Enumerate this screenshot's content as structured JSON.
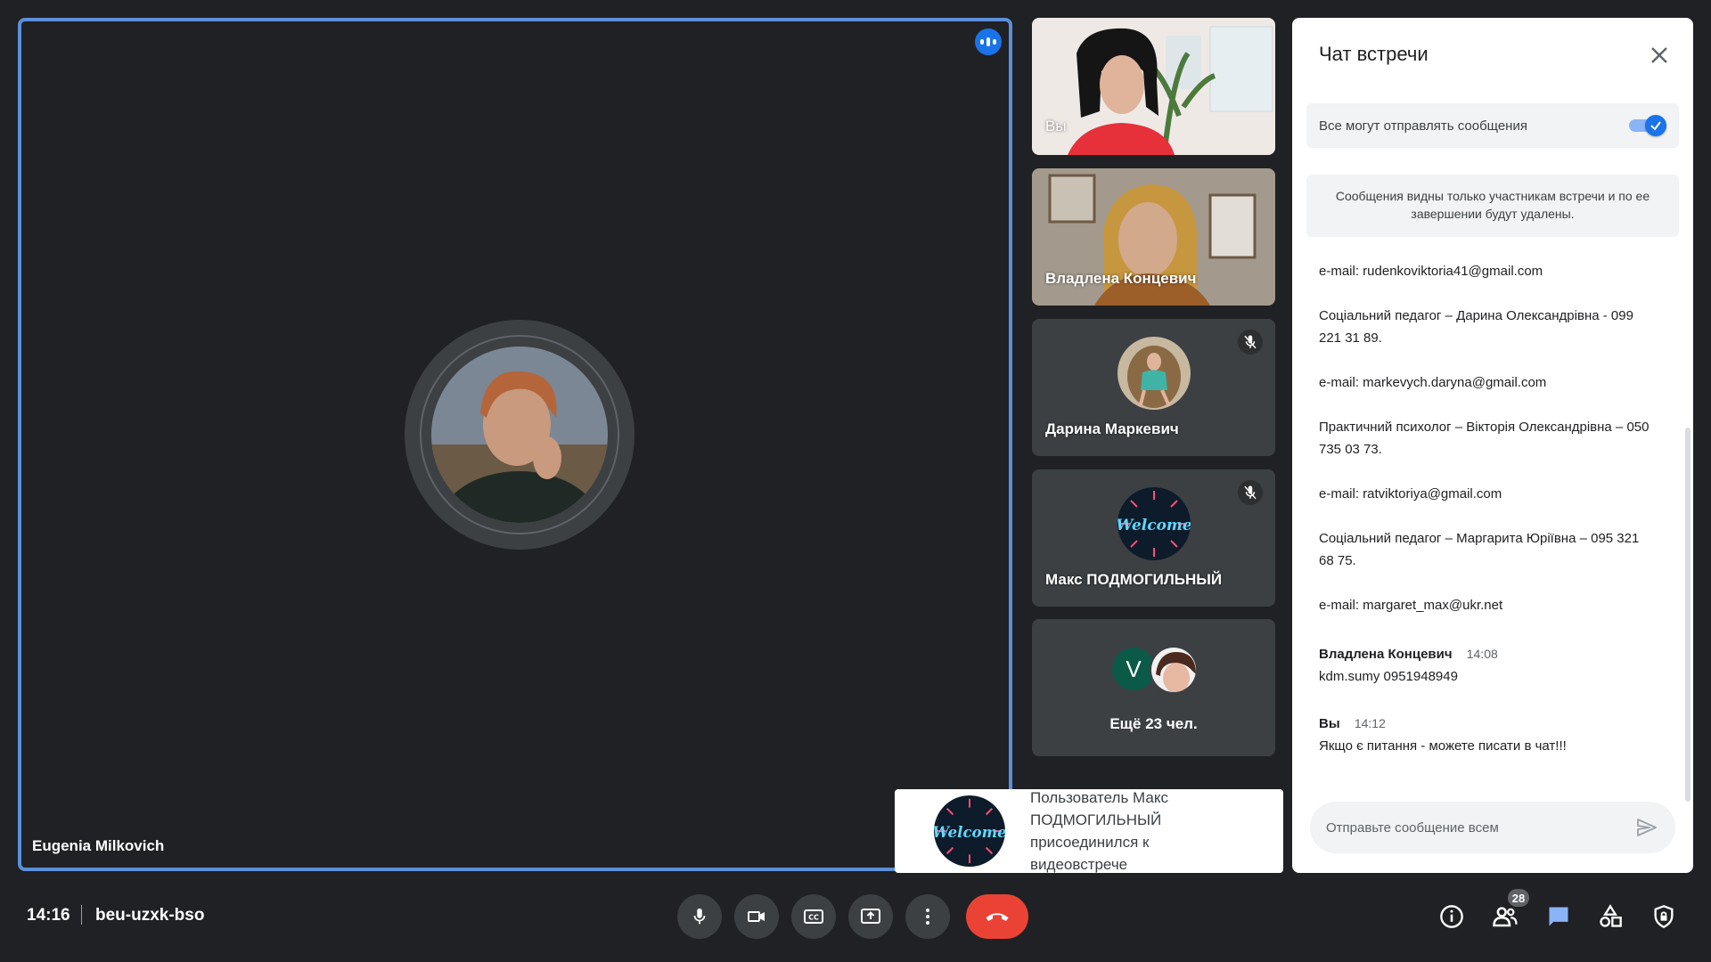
{
  "stage": {
    "participant_name": "Eugenia Milkovich"
  },
  "tiles": [
    {
      "name": "Вы",
      "muted": false
    },
    {
      "name": "Владлена Концевич",
      "muted": false
    },
    {
      "name": "Дарина Маркевич",
      "muted": true
    },
    {
      "name": "Макс ПОДМОГИЛЬНЫЙ",
      "muted": true
    },
    {
      "name": "Ещё 23 чел.",
      "avatar_letter": "V"
    }
  ],
  "chat": {
    "title": "Чат встречи",
    "toggle_label": "Все могут отправлять сообщения",
    "toggle_on": true,
    "notice": "Сообщения видны только участникам встречи и по ее завершении будут удалены.",
    "lines": [
      "e-mail: rudenkoviktoria41@gmail.com",
      "Соціальний педагог – Дарина Олександрівна - 099 221 31 89.",
      "e-mail: markevych.daryna@gmail.com",
      "Практичний психолог – Вікторія Олександрівна – 050 735 03 73.",
      "e-mail: ratviktoriya@gmail.com",
      "Соціальний педагог – Маргарита Юріївна – 095 321 68 75.",
      "e-mail: margaret_max@ukr.net"
    ],
    "messages": [
      {
        "author": "Владлена Концевич",
        "time": "14:08",
        "text": "kdm.sumy 0951948949"
      },
      {
        "author": "Вы",
        "time": "14:12",
        "text": "Якщо є питання - можете писати в чат!!!"
      }
    ],
    "input_placeholder": "Отправьте сообщение всем"
  },
  "toast": {
    "text": "Пользователь Макс ПОДМОГИЛЬНЫЙ присоединился к видеовстрече"
  },
  "bottom_bar": {
    "time": "14:16",
    "meeting_code": "beu-uzxk-bso",
    "participants_count": "28"
  },
  "colors": {
    "accent": "#1a73e8",
    "end_call": "#ea4335",
    "stage_border": "#5b8fd9"
  }
}
